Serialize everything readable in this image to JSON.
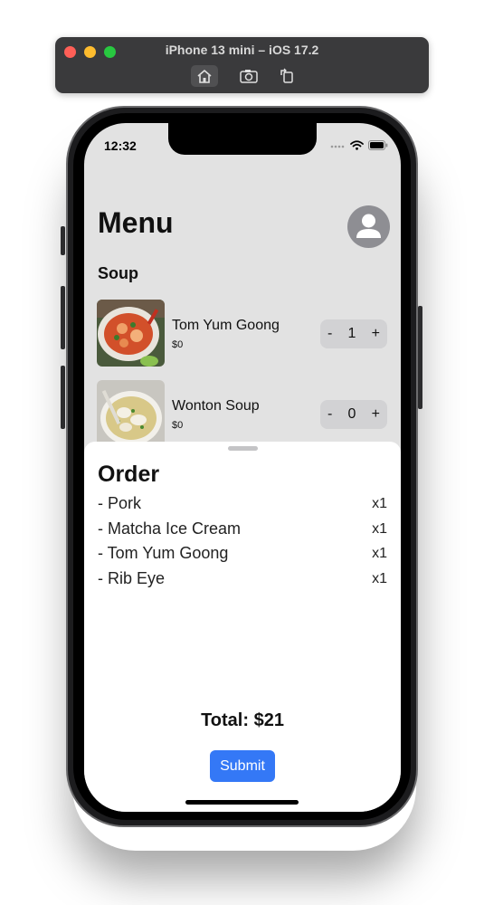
{
  "simulator": {
    "title": "iPhone 13 mini – iOS 17.2",
    "buttons": [
      "home-icon",
      "screenshot-icon",
      "rotate-icon"
    ]
  },
  "status_bar": {
    "time": "12:32"
  },
  "menu": {
    "title": "Menu",
    "section": "Soup",
    "items": [
      {
        "name": "Tom Yum Goong",
        "price": "$0",
        "quantity": "1",
        "minus": "-",
        "plus": "+"
      },
      {
        "name": "Wonton Soup",
        "price": "$0",
        "quantity": "0",
        "minus": "-",
        "plus": "+"
      }
    ]
  },
  "order": {
    "title": "Order",
    "lines": [
      {
        "name": "- Pork",
        "qty": "x1"
      },
      {
        "name": "- Matcha Ice Cream",
        "qty": "x1"
      },
      {
        "name": "- Tom Yum Goong",
        "qty": "x1"
      },
      {
        "name": "- Rib Eye",
        "qty": "x1"
      }
    ],
    "total": "Total: $21",
    "submit_label": "Submit"
  },
  "colors": {
    "accent": "#3478f6",
    "screen_bg": "#e2e2e2",
    "sheet_bg": "#ffffff"
  }
}
